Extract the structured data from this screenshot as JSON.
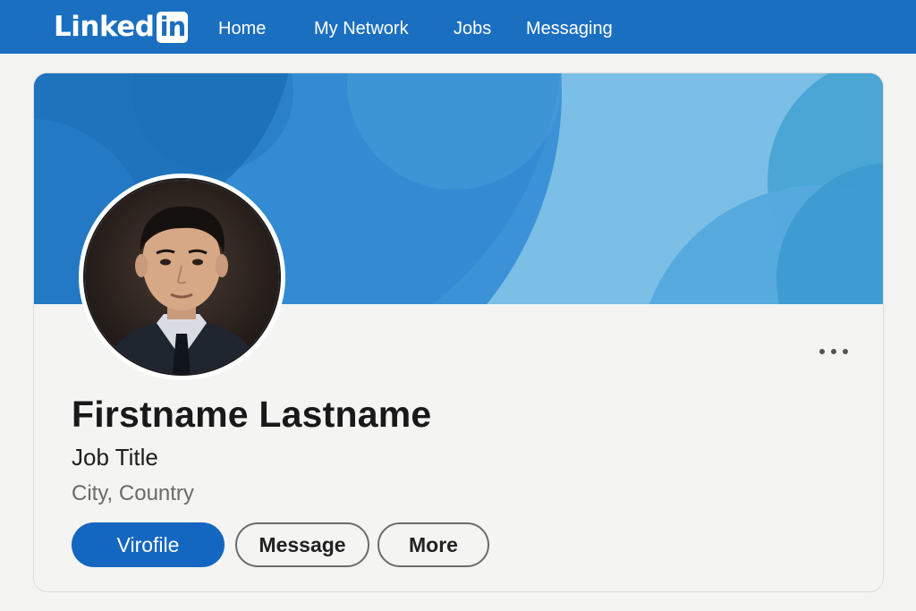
{
  "nav": {
    "logo_text": "Linked",
    "logo_box": "in",
    "items": [
      {
        "label": "Home"
      },
      {
        "label": "My Network"
      },
      {
        "label": "Jobs"
      },
      {
        "label": "Messaging"
      }
    ]
  },
  "profile": {
    "name": "Firstname Lastname",
    "job_title": "Job Title",
    "location": "City, Country",
    "more_icon": "ellipsis-icon"
  },
  "actions": {
    "primary_label": "Virofile",
    "message_label": "Message",
    "more_label": "More"
  },
  "colors": {
    "brand": "#1b6fc0",
    "primary_button": "#1467c0",
    "banner_light": "#7bbfe6",
    "banner_dark": "#1e78c4"
  }
}
